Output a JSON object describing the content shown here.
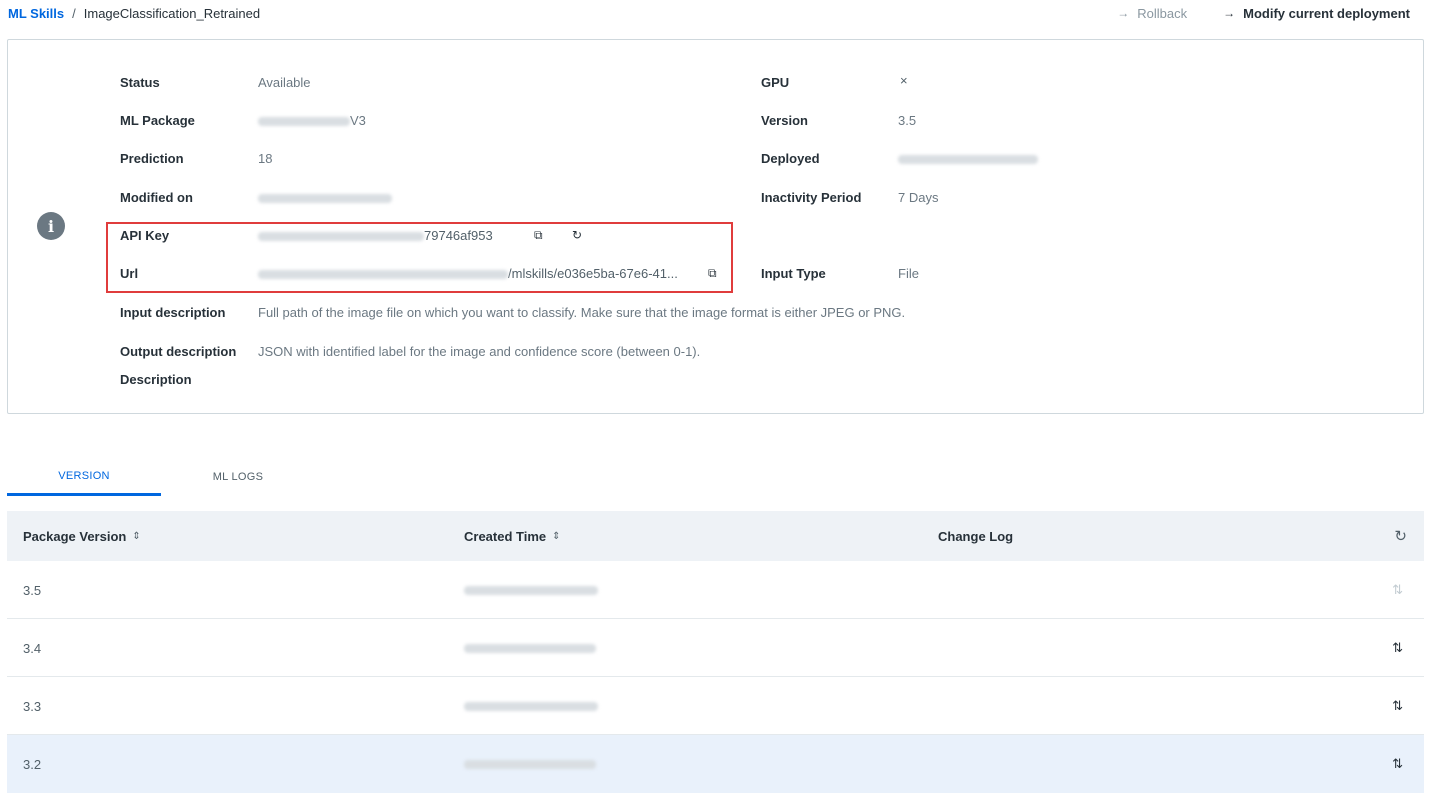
{
  "breadcrumb": {
    "root": "ML Skills",
    "separator": "/",
    "current": "ImageClassification_Retrained"
  },
  "header_actions": {
    "rollback": "Rollback",
    "modify": "Modify current deployment",
    "arrow": "→"
  },
  "details": {
    "status_label": "Status",
    "status_value": "Available",
    "package_label": "ML Package",
    "package_suffix": "V3",
    "prediction_label": "Prediction",
    "prediction_value": "18",
    "modified_label": "Modified on",
    "apikey_label": "API Key",
    "apikey_tail": "79746af953",
    "url_label": "Url",
    "url_tail": "/mlskills/e036e5ba-67e6-41...",
    "input_desc_label": "Input description",
    "input_desc_value": "Full path of the image file on which you want to classify. Make sure that the image format is either JPEG or PNG.",
    "output_desc_label": "Output description",
    "output_desc_value": "JSON with identified label for the image and confidence score (between 0-1).",
    "description_label": "Description",
    "gpu_label": "GPU",
    "gpu_value": "×",
    "version_label": "Version",
    "version_value": "3.5",
    "deployed_label": "Deployed",
    "inactivity_label": "Inactivity Period",
    "inactivity_value": "7 Days",
    "input_type_label": "Input Type",
    "input_type_value": "File",
    "info_glyph": "i"
  },
  "icons": {
    "copy": "⧉",
    "regenerate": "↻",
    "sort": "⇕",
    "refresh": "↻",
    "deploy": "⇅"
  },
  "tabs": [
    "VERSION",
    "ML LOGS"
  ],
  "table": {
    "headers": {
      "package_version": "Package Version",
      "created_time": "Created Time",
      "change_log": "Change Log"
    },
    "rows": [
      {
        "version": "3.5"
      },
      {
        "version": "3.4"
      },
      {
        "version": "3.3"
      },
      {
        "version": "3.2"
      }
    ]
  },
  "colors": {
    "accent": "#0067df",
    "highlight_box": "#e03c3c",
    "selected_row": "#e9f1fb"
  }
}
